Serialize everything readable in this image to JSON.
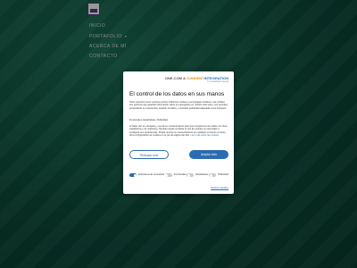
{
  "site": {
    "logo_icon": "crest-logo-icon",
    "nav": [
      {
        "label": "Inicio"
      },
      {
        "label": "Portafolio",
        "has_submenu": true
      },
      {
        "label": "Acerca de mí"
      },
      {
        "label": "Contacto"
      }
    ]
  },
  "consent": {
    "brand_prefix": "ONE.COM",
    "brand_connector": "&",
    "brand_partner": "CONSENT",
    "brand_partner_suffix": "INTEGRATION",
    "brand_tagline": "Tu privacidad importa",
    "title": "El control de los datos en sus manos",
    "intro": "Tanto nosotros como nuestros socios utilizamos cookies o tecnologías similares. Las cookies son archivos que guardan información sobre su navegación en nuestro sitio web y nos permiten personalizar su experiencia, analizar el tráfico y mostrarle publicidad adaptada a sus intereses.",
    "purposes": "Funcionales, Estadísticas, Publicidad",
    "details": "Al hacer clic en «Aceptar», nos da su consentimiento para que recopilemos sus datos con fines estadísticos y de marketing. También puede rechazar el uso de cookies no esenciales o configurar sus preferencias. Puede revocar su consentimiento en cualquier momento a través de la configuración de cookies en el pie de página del sitio.",
    "details_link": "Leer más sobre las cookies",
    "reject_label": "Rechazar todo",
    "accept_label": "Aceptar todo",
    "toggles": [
      {
        "label": "Estrictamente necesarias",
        "on": true
      },
      {
        "label": "Funcionales",
        "on": false
      },
      {
        "label": "Estadísticas",
        "on": false
      },
      {
        "label": "Publicidad",
        "on": false
      }
    ],
    "settings_link": "Mostrar detalles"
  },
  "colors": {
    "background": "#0e4d3d",
    "accent": "#2b6cb0",
    "brand_orange": "#e58a00"
  }
}
